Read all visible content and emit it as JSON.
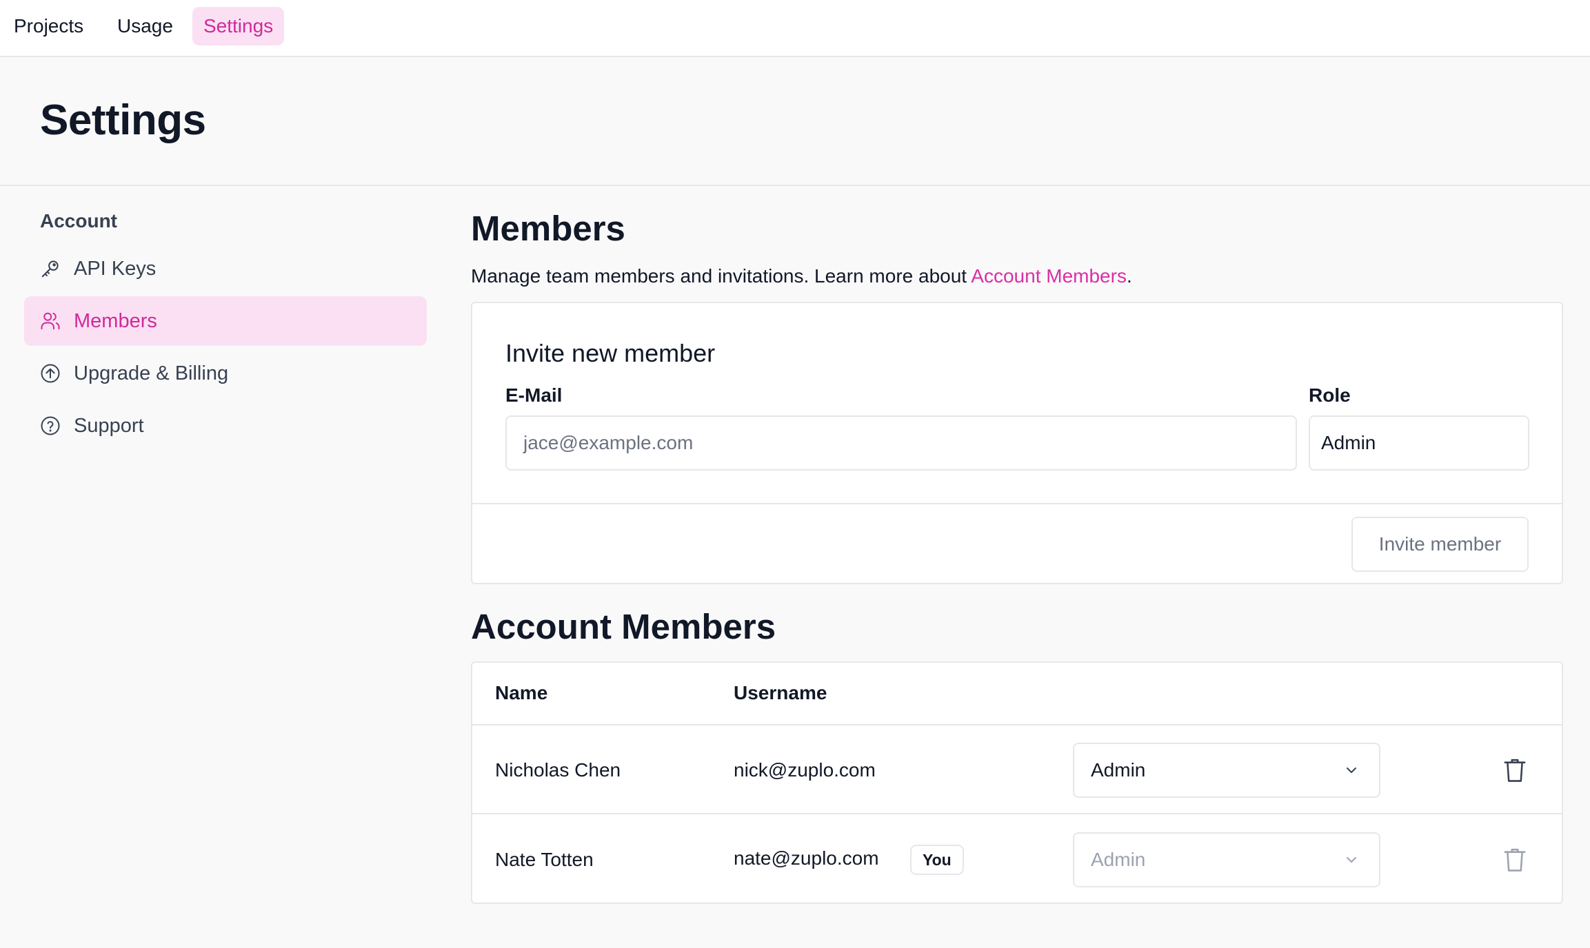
{
  "topnav": {
    "tabs": [
      {
        "label": "Projects",
        "active": false
      },
      {
        "label": "Usage",
        "active": false
      },
      {
        "label": "Settings",
        "active": true
      }
    ]
  },
  "page": {
    "title": "Settings"
  },
  "sidebar": {
    "heading": "Account",
    "items": [
      {
        "label": "API Keys",
        "icon": "key-icon",
        "active": false
      },
      {
        "label": "Members",
        "icon": "users-icon",
        "active": true
      },
      {
        "label": "Upgrade & Billing",
        "icon": "arrow-up-circle-icon",
        "active": false
      },
      {
        "label": "Support",
        "icon": "question-circle-icon",
        "active": false
      }
    ]
  },
  "members": {
    "title": "Members",
    "description_prefix": "Manage team members and invitations. Learn more about ",
    "description_link": "Account Members",
    "description_suffix": "."
  },
  "invite": {
    "title": "Invite new member",
    "email_label": "E-Mail",
    "email_placeholder": "jace@example.com",
    "role_label": "Role",
    "role_value": "Admin",
    "button_label": "Invite member"
  },
  "account_members": {
    "title": "Account Members",
    "columns": [
      "Name",
      "Username"
    ],
    "rows": [
      {
        "name": "Nicholas Chen",
        "username": "nick@zuplo.com",
        "badge": "",
        "role": "Admin",
        "disabled": false
      },
      {
        "name": "Nate Totten",
        "username": "nate@zuplo.com",
        "badge": "You",
        "role": "Admin",
        "disabled": true
      }
    ]
  },
  "colors": {
    "accent": "#cf2a9a",
    "accent_bg": "#fbe0f3",
    "link": "#db2ea6",
    "border": "#e5e7eb",
    "page_bg": "#f9f9fa"
  }
}
